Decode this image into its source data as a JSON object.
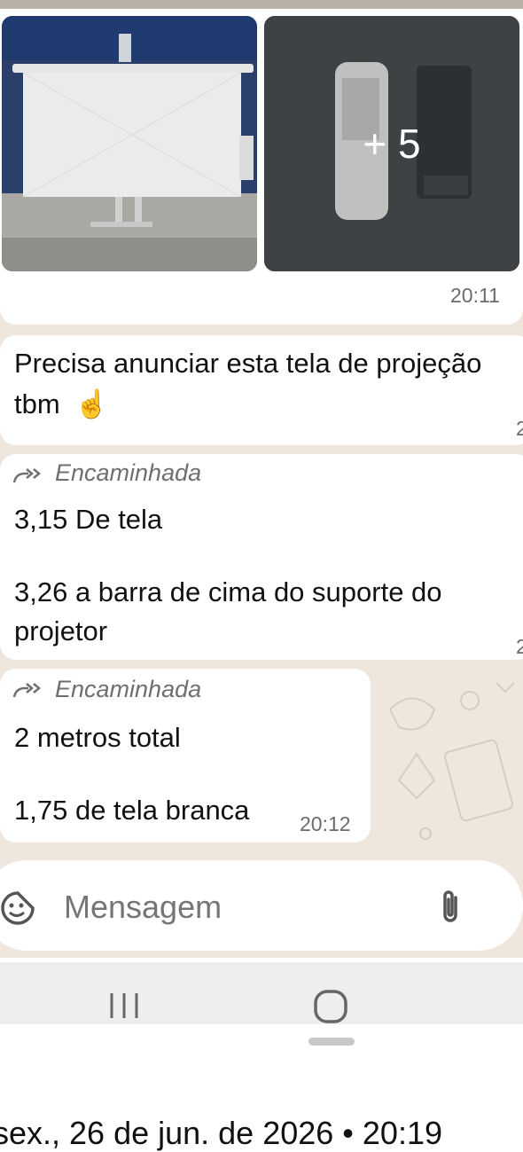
{
  "media": {
    "more_count": "+ 5",
    "time": "20:11"
  },
  "messages": [
    {
      "lines": [
        "Precisa anunciar esta tela de projeção",
        "tbm"
      ],
      "emoji": "☝",
      "time": "2"
    },
    {
      "forwarded_label": "Encaminhada",
      "lines": [
        "3,15 De tela",
        "3,26 a barra de cima do suporte do",
        "projetor"
      ],
      "time": "2"
    },
    {
      "forwarded_label": "Encaminhada",
      "lines": [
        "2 metros total",
        "1,75 de tela branca"
      ],
      "time": "20:12"
    }
  ],
  "composer": {
    "placeholder": "Mensagem",
    "emoji_icon": "sticker-emoji-icon",
    "attach_icon": "paperclip-icon"
  },
  "navbar": {
    "icons": [
      "recent-apps-icon",
      "home-icon"
    ]
  },
  "footer_caption": "sex., 26 de jun. de 2026 • 20:19"
}
